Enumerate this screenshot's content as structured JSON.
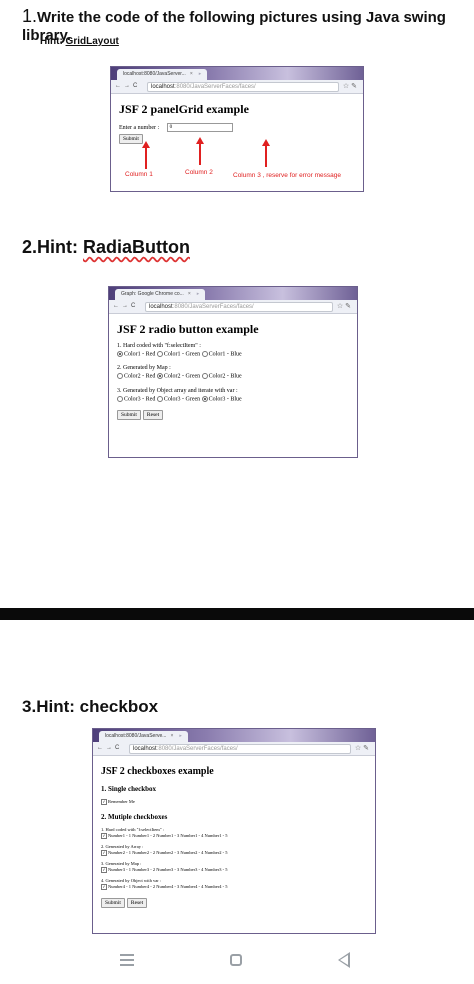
{
  "q1": {
    "number": "1.",
    "title": "Write the code of the following pictures using Java swing library.",
    "hint_label": "Hint: ",
    "hint_value": "GridLayout"
  },
  "w1": {
    "tab": "localhost:8080/JavaServer...",
    "url_host": "localhost",
    "url_path": ":8080/JavaServerFaces/faces/",
    "heading": "JSF 2 panelGrid example",
    "field_label": "Enter a number :",
    "field_value": "0",
    "submit": "Submit",
    "col1": "Column 1",
    "col2": "Column 2",
    "col3": "Column 3 , reserve for error message"
  },
  "q2": {
    "number": "2.",
    "hint_label": "Hint: ",
    "hint_value": "RadiaButton"
  },
  "w2": {
    "tab": "Graph: Google Chrome co...",
    "url_host": "localhost",
    "url_path": ":8080/JavaServerFaces/faces/",
    "heading": "JSF 2 radio button example",
    "g1_label": "1. Hard coded with \"f:selectItem\" :",
    "g1_opts": [
      "Color1 - Red",
      "Color1 - Green",
      "Color1 - Blue"
    ],
    "g2_label": "2. Generated by Map :",
    "g2_opts": [
      "Color2 - Red",
      "Color2 - Green",
      "Color2 - Blue"
    ],
    "g3_label": "3. Generated by Object array and iterate with var :",
    "g3_opts": [
      "Color3 - Red",
      "Color3 - Green",
      "Color3 - Blue"
    ],
    "submit": "Submit",
    "reset": "Reset"
  },
  "q3": {
    "number": "3.",
    "hint_label": "Hint: ",
    "hint_value": "checkbox"
  },
  "w3": {
    "tab": "localhost:8080/JavaServe...",
    "url_host": "localhost",
    "url_path": ":8080/JavaServerFaces/faces/",
    "heading": "JSF 2 checkboxes example",
    "single_heading": "1. Single checkbox",
    "remember": "Remember Me",
    "multi_heading": "2. Mutiple checkboxes",
    "m1_label": "1. Hard coded with \"f:selectItem\" :",
    "m1": "Number1 - 1   Number1 - 2   Number1 - 3   Number1 - 4   Number1 - 5",
    "m2_label": "2. Generated by Array :",
    "m2": "Number2 - 1   Number2 - 2   Number2 - 3   Number2 - 4   Number2 - 5",
    "m3_label": "3. Generated by Map :",
    "m3": "Number3 - 1   Number3 - 2   Number3 - 3   Number3 - 4   Number3 - 5",
    "m4_label": "4. Generated by Object with var :",
    "m4": "Number4 - 1   Number4 - 2   Number4 - 3   Number4 - 4   Number4 - 5",
    "submit": "Submit",
    "reset": "Reset"
  }
}
